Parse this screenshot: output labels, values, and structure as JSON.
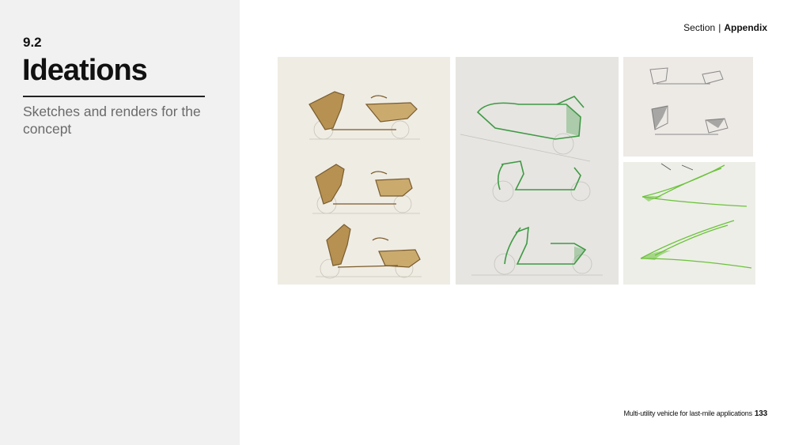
{
  "slide": {
    "section_number": "9.2",
    "title": "Ideations",
    "subtitle": "Sketches and renders for the concept"
  },
  "header": {
    "section_prefix": "Section",
    "separator": "|",
    "section_name": "Appendix"
  },
  "footer": {
    "project": "Multi-utility vehicle for last-mile applications",
    "page_number": "133"
  },
  "images": [
    {
      "subject": "gold-brown scooter concept sketches",
      "color": "#a07a2e"
    },
    {
      "subject": "green scooter concept sketches",
      "color": "#3f9a45"
    },
    {
      "subject": "grey scooter form sketches",
      "color": "#555555"
    },
    {
      "subject": "green leaf-shaped form sketches",
      "color": "#6cc23a"
    }
  ]
}
